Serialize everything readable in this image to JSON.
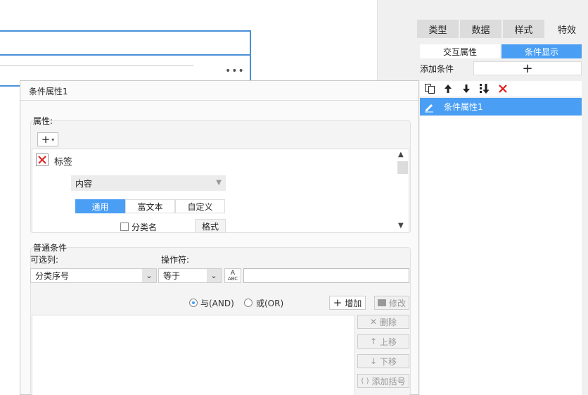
{
  "right_panel": {
    "tabs": [
      "类型",
      "数据",
      "样式",
      "特效"
    ],
    "subtabs": {
      "interaction": "交互属性",
      "condition_display": "条件显示"
    },
    "add_condition_label": "添加条件",
    "add_condition_button": "+",
    "toolbar_icons": [
      "copy-icon",
      "arrow-up-icon",
      "arrow-down-icon",
      "move-bottom-icon",
      "delete-icon"
    ],
    "conditions": [
      {
        "label": "条件属性1",
        "selected": true
      }
    ]
  },
  "dialog": {
    "title": "条件属性1",
    "properties": {
      "label": "属性:",
      "add_button": "+",
      "item_label": "标签",
      "content_select": "内容",
      "segments": [
        "通用",
        "富文本",
        "自定义"
      ],
      "category_name_checkbox": "分类名",
      "format_button": "格式"
    },
    "condition": {
      "group_label": "普通条件",
      "optional_column_label": "可选列:",
      "operator_label": "操作符:",
      "column_value": "分类序号",
      "operator_value": "等于",
      "value_input": "",
      "abc_icon_text": [
        "A",
        "ABC"
      ],
      "radio_and": "与(AND)",
      "radio_or": "或(OR)",
      "add_button": "增加",
      "modify_button": "修改",
      "delete_button": "删除",
      "move_up_button": "上移",
      "move_down_button": "下移",
      "add_bracket_button": "添加括号"
    }
  },
  "canvas": {
    "more_label": "•••"
  },
  "colors": {
    "accent": "#4a9ff5",
    "frame_blue": "#4a90d9",
    "delete_red": "#e02020"
  }
}
